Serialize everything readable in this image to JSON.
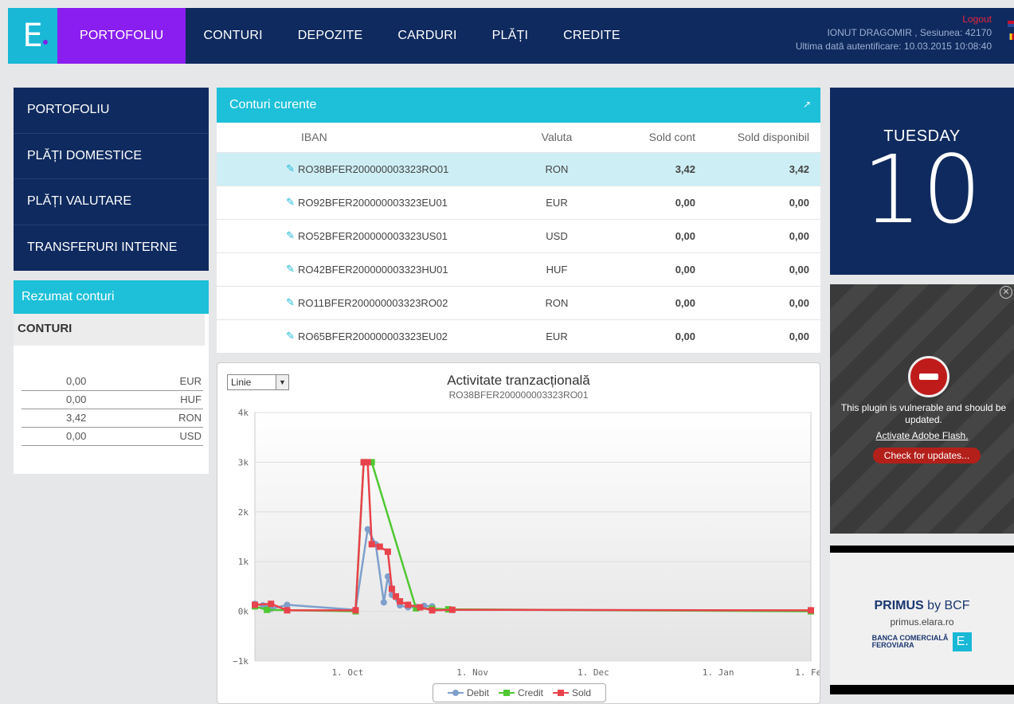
{
  "nav": {
    "logo": "E.",
    "items": [
      {
        "label": "PORTOFOLIU",
        "active": true
      },
      {
        "label": "CONTURI"
      },
      {
        "label": "DEPOZITE"
      },
      {
        "label": "CARDURI"
      },
      {
        "label": "PLĂȚI"
      },
      {
        "label": "CREDITE"
      }
    ],
    "user": {
      "logout": "Logout",
      "session": "IONUT DRAGOMIR , Sesiunea: 42170",
      "last_login": "Ultima dată autentificare: 10.03.2015 10:08:40"
    }
  },
  "sidebar": {
    "items": [
      "PORTOFOLIU",
      "PLĂȚI DOMESTICE",
      "PLĂȚI VALUTARE",
      "TRANSFERURI INTERNE"
    ]
  },
  "summary": {
    "title": "Rezumat conturi",
    "subtitle": "CONTURI",
    "rows": [
      {
        "value": "0,00",
        "currency": "EUR"
      },
      {
        "value": "0,00",
        "currency": "HUF"
      },
      {
        "value": "3,42",
        "currency": "RON"
      },
      {
        "value": "0,00",
        "currency": "USD"
      }
    ]
  },
  "accounts": {
    "title": "Conturi curente",
    "columns": {
      "iban": "IBAN",
      "currency": "Valuta",
      "balance": "Sold cont",
      "available": "Sold disponibil"
    },
    "rows": [
      {
        "iban": "RO38BFER200000003323RO01",
        "currency": "RON",
        "balance": "3,42",
        "available": "3,42",
        "selected": true
      },
      {
        "iban": "RO92BFER200000003323EU01",
        "currency": "EUR",
        "balance": "0,00",
        "available": "0,00"
      },
      {
        "iban": "RO52BFER200000003323US01",
        "currency": "USD",
        "balance": "0,00",
        "available": "0,00"
      },
      {
        "iban": "RO42BFER200000003323HU01",
        "currency": "HUF",
        "balance": "0,00",
        "available": "0,00"
      },
      {
        "iban": "RO11BFER200000003323RO02",
        "currency": "RON",
        "balance": "0,00",
        "available": "0,00"
      },
      {
        "iban": "RO65BFER200000003323EU02",
        "currency": "EUR",
        "balance": "0,00",
        "available": "0,00"
      }
    ]
  },
  "chart": {
    "select_value": "Linie",
    "title": "Activitate tranzacțională",
    "subtitle": "RO38BFER200000003323RO01"
  },
  "chart_data": {
    "type": "line",
    "x_ticks": [
      "1. Oct",
      "1. Nov",
      "1. Dec",
      "1. Jan",
      "1. Feb"
    ],
    "y_ticks": [
      "−1k",
      "0k",
      "1k",
      "2k",
      "3k",
      "4k"
    ],
    "ylim": [
      -1000,
      4000
    ],
    "x_unit": "days from start",
    "xlim": [
      0,
      138
    ],
    "series": [
      {
        "name": "Debit",
        "color": "#7f9fcc",
        "marker": "circle",
        "points": [
          [
            0,
            150
          ],
          [
            2,
            120
          ],
          [
            3,
            60
          ],
          [
            4,
            50
          ],
          [
            8,
            130
          ],
          [
            25,
            30
          ],
          [
            28,
            1650
          ],
          [
            30,
            1350
          ],
          [
            32,
            180
          ],
          [
            33,
            700
          ],
          [
            34,
            330
          ],
          [
            36,
            120
          ],
          [
            38,
            80
          ],
          [
            40,
            90
          ],
          [
            42,
            110
          ],
          [
            44,
            100
          ]
        ]
      },
      {
        "name": "Credit",
        "color": "#4fc832",
        "marker": "diamond",
        "points": [
          [
            0,
            100
          ],
          [
            3,
            30
          ],
          [
            25,
            0
          ],
          [
            27,
            3000
          ],
          [
            29,
            3000
          ],
          [
            40,
            60
          ],
          [
            44,
            50
          ],
          [
            48,
            40
          ],
          [
            138,
            0
          ]
        ]
      },
      {
        "name": "Sold",
        "color": "#e8434c",
        "marker": "square",
        "points": [
          [
            0,
            130
          ],
          [
            4,
            150
          ],
          [
            8,
            20
          ],
          [
            25,
            20
          ],
          [
            27,
            3000
          ],
          [
            28,
            3000
          ],
          [
            29,
            1350
          ],
          [
            31,
            1300
          ],
          [
            33,
            1200
          ],
          [
            34,
            450
          ],
          [
            35,
            300
          ],
          [
            36,
            200
          ],
          [
            38,
            130
          ],
          [
            41,
            80
          ],
          [
            44,
            20
          ],
          [
            49,
            30
          ],
          [
            138,
            20
          ]
        ]
      }
    ]
  },
  "calendar": {
    "weekday": "TUESDAY",
    "day": "10"
  },
  "flash": {
    "close": "✕",
    "message": "This plugin is vulnerable and should be updated.",
    "link": "Activate Adobe Flash.",
    "button": "Check for updates..."
  },
  "ad": {
    "title_bold": "PRIMUS",
    "title_rest": " by BCF",
    "url": "primus.elara.ro",
    "bank_line1": "BANCA COMERCIALĂ",
    "bank_line2": "FEROVIARA",
    "logo": "E."
  }
}
